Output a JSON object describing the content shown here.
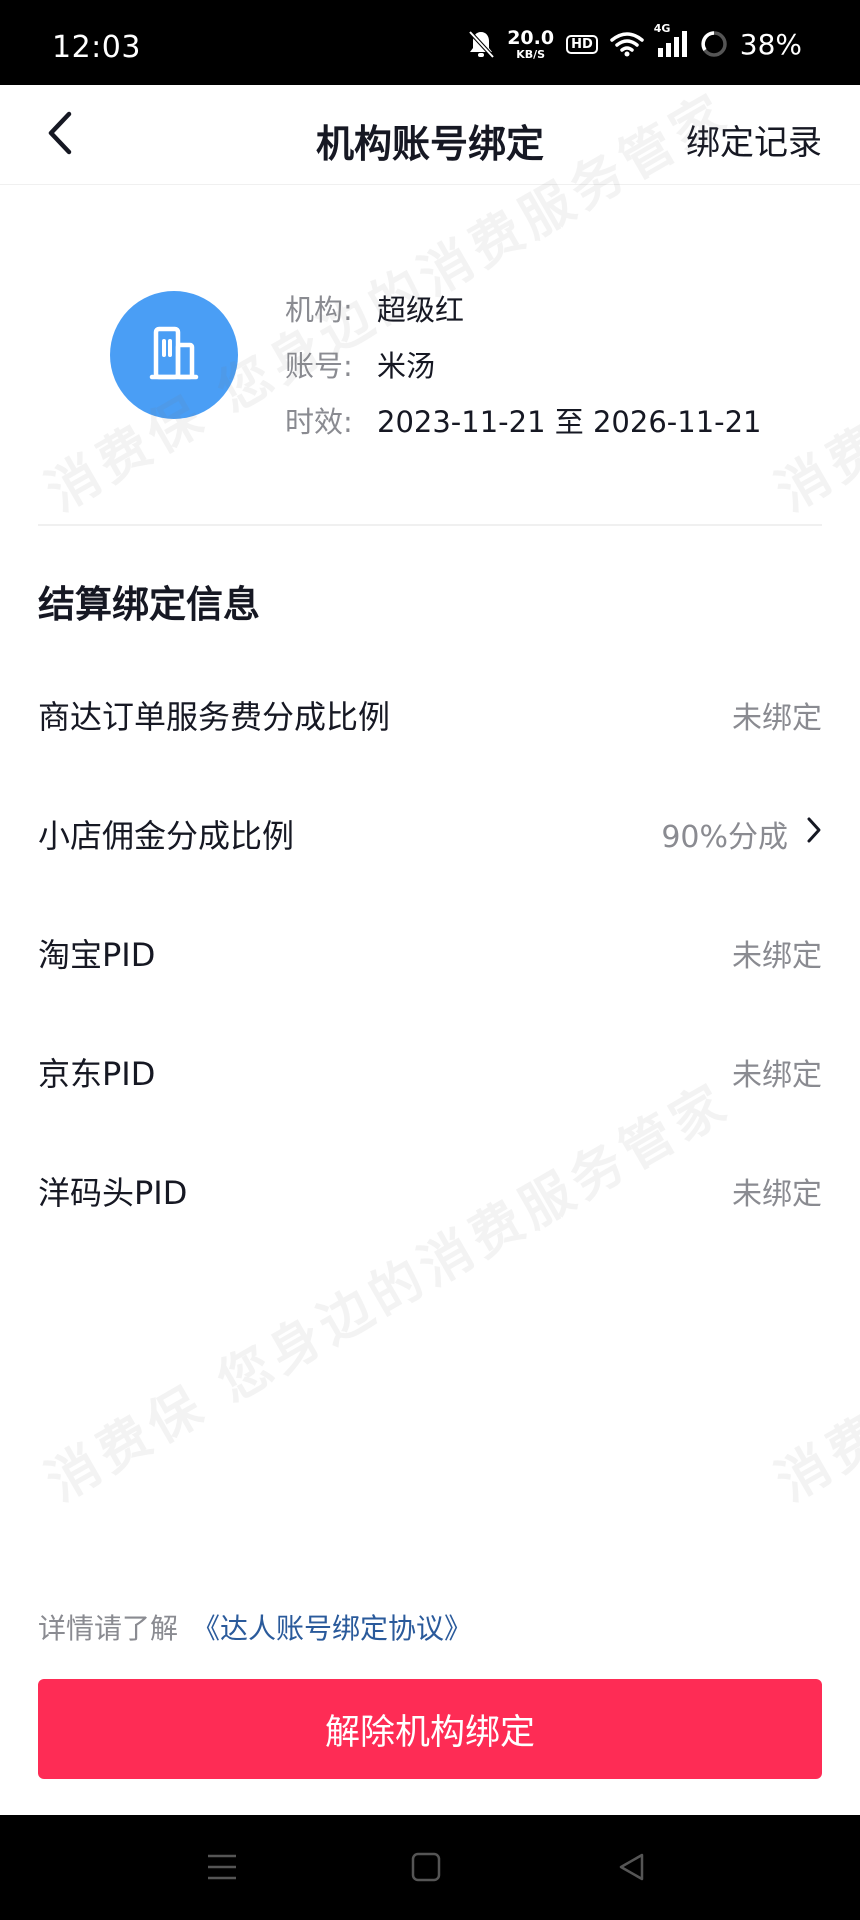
{
  "status_bar": {
    "time": "12:03",
    "net_speed_value": "20.0",
    "net_speed_unit": "KB/S",
    "hd": "HD",
    "network": "4G",
    "battery": "38%"
  },
  "header": {
    "title": "机构账号绑定",
    "right_link": "绑定记录"
  },
  "org": {
    "icon": "building-icon",
    "rows": [
      {
        "key": "机构:",
        "value": "超级红"
      },
      {
        "key": "账号:",
        "value": "米汤"
      },
      {
        "key": "时效:",
        "value": "2023-11-21 至 2026-11-21"
      }
    ]
  },
  "settlement": {
    "title": "结算绑定信息",
    "items": [
      {
        "label": "商达订单服务费分成比例",
        "value": "未绑定"
      },
      {
        "label": "小店佣金分成比例",
        "value": "90%分成"
      },
      {
        "label": "淘宝PID",
        "value": "未绑定"
      },
      {
        "label": "京东PID",
        "value": "未绑定"
      },
      {
        "label": "洋码头PID",
        "value": "未绑定"
      }
    ]
  },
  "footer": {
    "agreement_prefix": "详情请了解",
    "agreement_link": "《达人账号绑定协议》",
    "unbind_button": "解除机构绑定"
  },
  "watermark": "消费保 您身边的消费服务管家",
  "colors": {
    "primary_button": "#fe2c55",
    "avatar_bg": "#4a9ef5",
    "link": "#2a5a9b"
  }
}
